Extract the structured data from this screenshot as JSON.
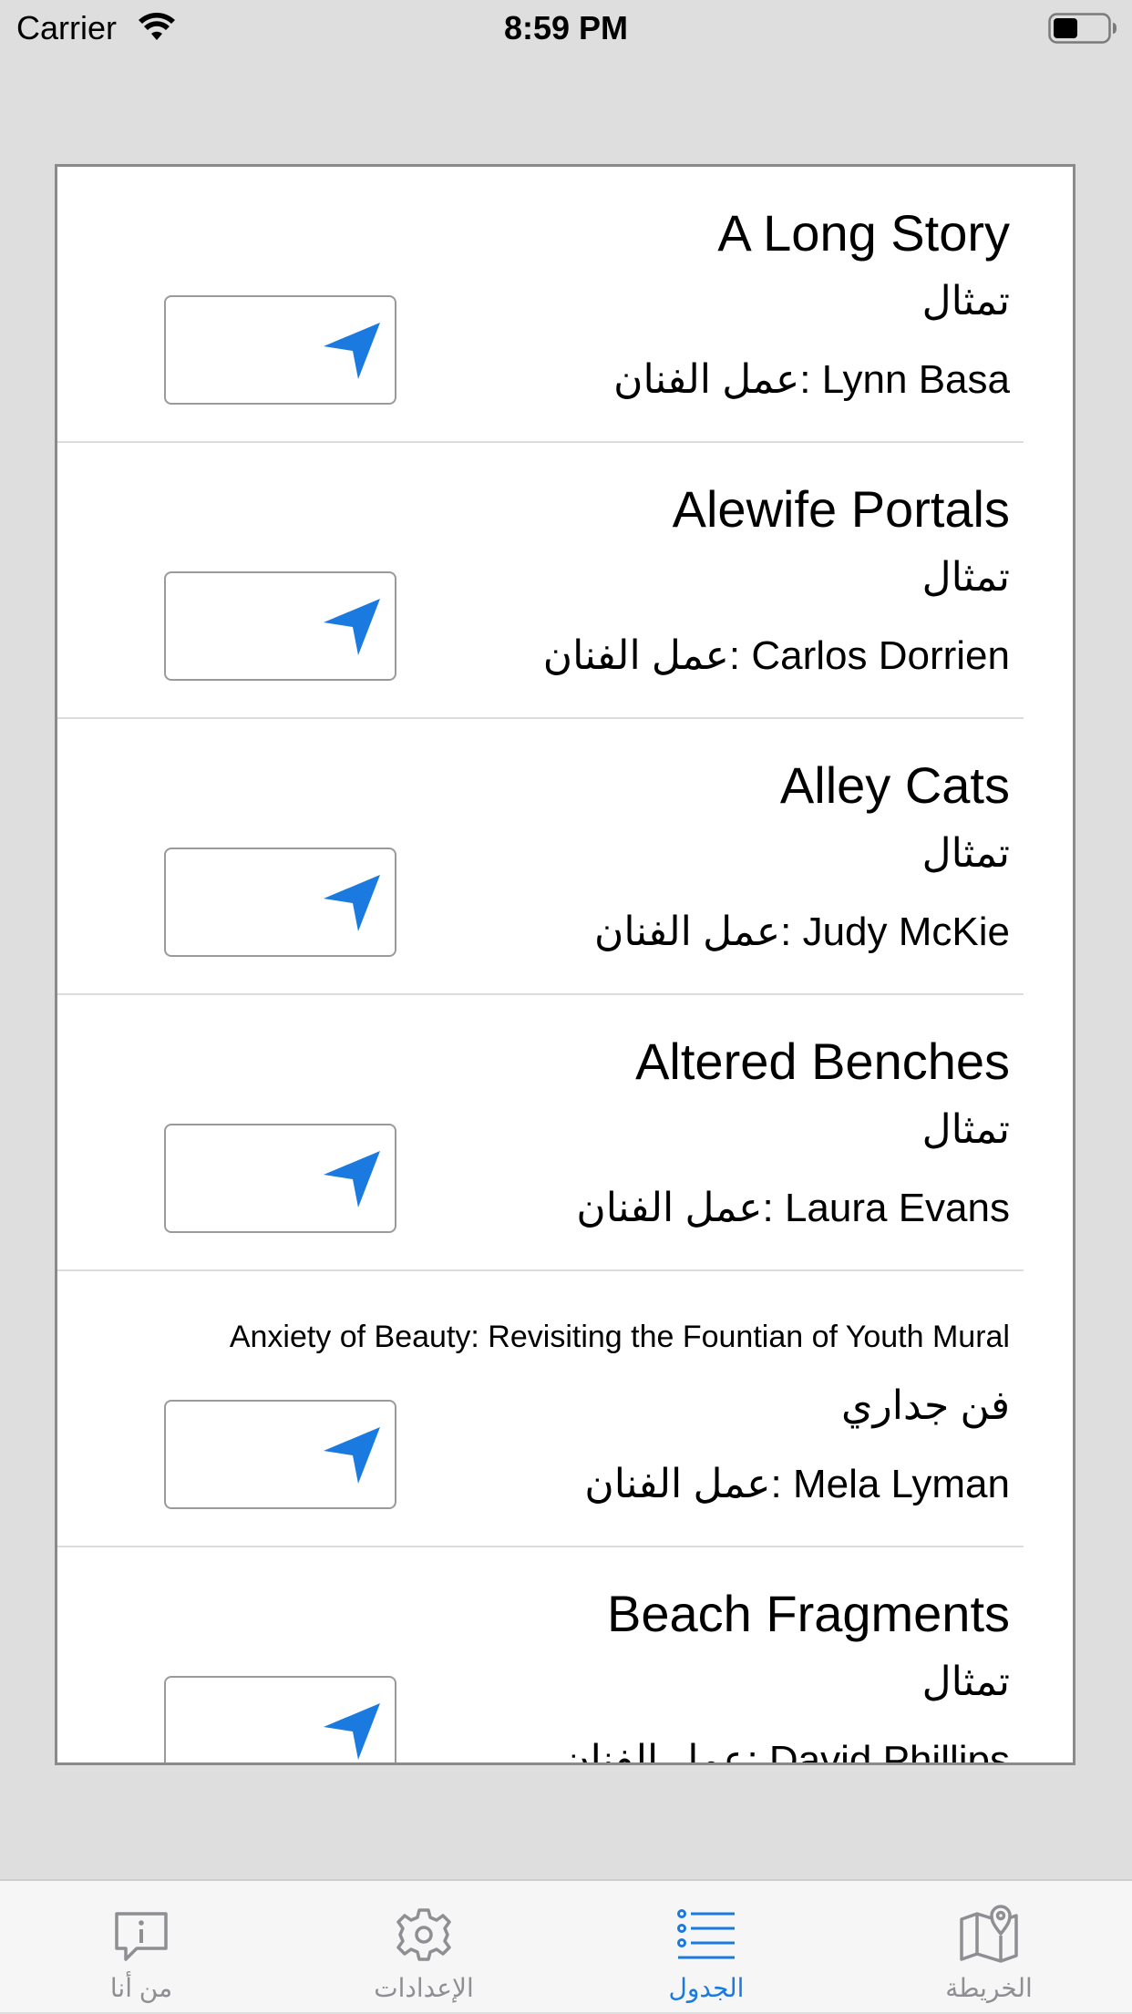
{
  "status_bar": {
    "carrier": "Carrier",
    "time": "8:59 PM"
  },
  "list": {
    "rows": [
      {
        "title": "A Long Story",
        "type": "تمثال",
        "artist": "عمل الفنان: Lynn Basa"
      },
      {
        "title": "Alewife Portals",
        "type": "تمثال",
        "artist": "عمل الفنان: Carlos Dorrien"
      },
      {
        "title": "Alley Cats",
        "type": "تمثال",
        "artist": "عمل الفنان: Judy McKie"
      },
      {
        "title": "Altered Benches",
        "type": "تمثال",
        "artist": "عمل الفنان: Laura Evans"
      },
      {
        "title": "Anxiety of Beauty: Revisiting the Fountian of Youth Mural",
        "type": "فن جداري",
        "artist": "عمل الفنان: Mela Lyman"
      },
      {
        "title": "Beach Fragments",
        "type": "تمثال",
        "artist": "عمل الفنان: David Phillips"
      }
    ],
    "nav_icon": "location-arrow-icon"
  },
  "tab_bar": {
    "tabs": [
      {
        "label": "من أنا",
        "icon": "info-bubble-icon"
      },
      {
        "label": "الإعدادات",
        "icon": "gear-icon"
      },
      {
        "label": "الجدول",
        "icon": "list-icon"
      },
      {
        "label": "الخريطة",
        "icon": "map-icon"
      }
    ],
    "active_color": "#1a7ae0",
    "inactive_color": "#8e8e93"
  },
  "colors": {
    "accent": "#1a7ae0",
    "background": "#dedede"
  }
}
